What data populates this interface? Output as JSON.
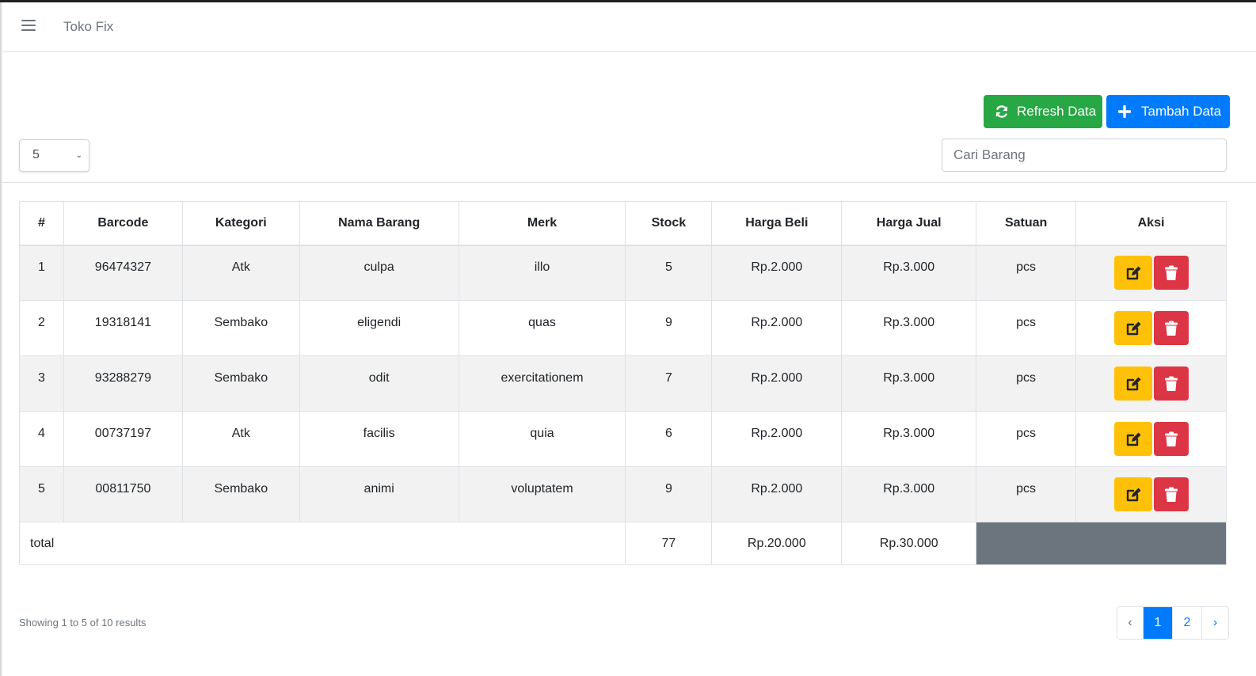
{
  "navbar": {
    "brand": "Toko Fix",
    "menu_icon": "hamburger-icon"
  },
  "toolbar": {
    "refresh_label": "Refresh Data",
    "refresh_icon": "sync-icon",
    "add_label": "Tambah Data",
    "add_icon": "plus-icon"
  },
  "page_size": {
    "selected": "5"
  },
  "search": {
    "placeholder": "Cari Barang",
    "value": ""
  },
  "table": {
    "headers": [
      "#",
      "Barcode",
      "Kategori",
      "Nama Barang",
      "Merk",
      "Stock",
      "Harga Beli",
      "Harga Jual",
      "Satuan",
      "Aksi"
    ],
    "rows": [
      [
        "1",
        "96474327",
        "Atk",
        "culpa",
        "illo",
        "5",
        "Rp.2.000",
        "Rp.3.000",
        "pcs"
      ],
      [
        "2",
        "19318141",
        "Sembako",
        "eligendi",
        "quas",
        "9",
        "Rp.2.000",
        "Rp.3.000",
        "pcs"
      ],
      [
        "3",
        "93288279",
        "Sembako",
        "odit",
        "exercitationem",
        "7",
        "Rp.2.000",
        "Rp.3.000",
        "pcs"
      ],
      [
        "4",
        "00737197",
        "Atk",
        "facilis",
        "quia",
        "6",
        "Rp.2.000",
        "Rp.3.000",
        "pcs"
      ],
      [
        "5",
        "00811750",
        "Sembako",
        "animi",
        "voluptatem",
        "9",
        "Rp.2.000",
        "Rp.3.000",
        "pcs"
      ]
    ],
    "footer": {
      "label": "total",
      "stock": "77",
      "harga_beli": "Rp.20.000",
      "harga_jual": "Rp.30.000"
    },
    "action_icons": {
      "edit": "edit-icon",
      "delete": "trash-icon"
    }
  },
  "info": {
    "showing": "Showing 1 to 5 of 10 results"
  },
  "pagination": {
    "prev": "‹",
    "pages": [
      "1",
      "2"
    ],
    "current": "1",
    "next": "›"
  },
  "colors": {
    "success": "#28a745",
    "primary": "#007bff",
    "warning": "#ffc107",
    "danger": "#dc3545",
    "secondary": "#6c757d"
  }
}
